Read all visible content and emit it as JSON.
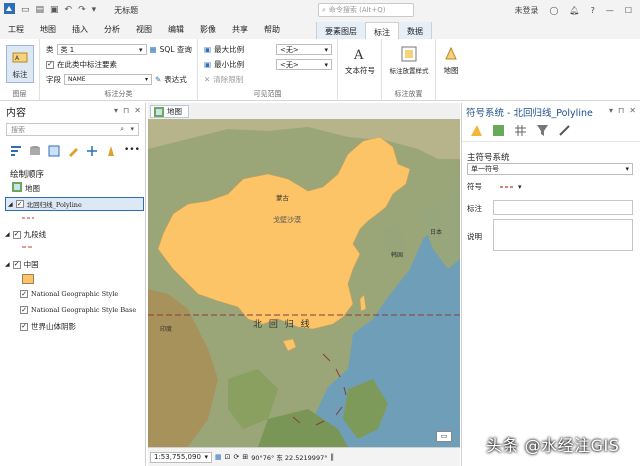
{
  "titlebar": {
    "doc_title": "无标题",
    "command_search_placeholder": "命令搜索 (Alt+Q)",
    "user": "未登录",
    "help": "?"
  },
  "ribbon_tabs": [
    "工程",
    "地图",
    "插入",
    "分析",
    "视图",
    "编辑",
    "影像",
    "共享",
    "帮助"
  ],
  "context_tabs": [
    "要素图层",
    "标注",
    "数据"
  ],
  "ribbon": {
    "layer_group": {
      "button": "标注",
      "label": "图层"
    },
    "class_group": {
      "class_label": "类",
      "class_value": "类 1",
      "sql_button": "SQL 查询",
      "label_features_check": "在此类中标注要素",
      "field_label": "字段",
      "field_value": "NAME",
      "expression_button": "表达式",
      "label": "标注分类"
    },
    "visible_range": {
      "max_scale": "最大比例",
      "min_scale": "最小比例",
      "clear_limits": "清除限制",
      "max_value": "<无>",
      "min_value": "<无>",
      "label": "可见范围"
    },
    "text_symbol": {
      "button": "文本符号",
      "label": ""
    },
    "label_placement": {
      "button": "标注放置样式",
      "label": "标注放置"
    },
    "map_group": {
      "button": "地图",
      "label": ""
    }
  },
  "contents": {
    "title": "内容",
    "search_placeholder": "搜索",
    "drawing_order": "绘制顺序",
    "layers": {
      "map": "地图",
      "tropic": "北回归线_Polyline",
      "nine_dash": "九段线",
      "china": "中国",
      "ngs": "National Geographic Style",
      "ngs_base": "National Geographic Style Base",
      "hillshade": "世界山体阴影"
    }
  },
  "map": {
    "tab": "地图",
    "labels": {
      "mongolia": "蒙古",
      "gobi": "戈壁沙漠",
      "korea": "韩国",
      "japan": "日本",
      "india": "印度",
      "tropic_label": "北 回 归 线"
    },
    "scale": "1:53,755,090",
    "coordinates": "90°76° 东 22.5219997°"
  },
  "symbology": {
    "title": "符号系统 - 北回归线_Polyline",
    "primary": "主符号系统",
    "primary_value": "单一符号",
    "symbol_label": "符号",
    "label_label": "标注",
    "description_label": "说明"
  },
  "watermark": "头条 @水经注GIS",
  "colors": {
    "china_fill": "#fcc466",
    "accent": "#1f4e8c",
    "tropic_line": "#8b3a3a"
  }
}
